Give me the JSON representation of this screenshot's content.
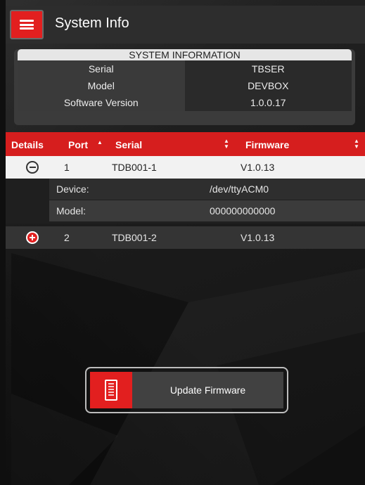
{
  "header": {
    "title": "System Info",
    "menu_icon": "hamburger-menu-icon"
  },
  "system_info": {
    "heading": "SYSTEM INFORMATION",
    "rows": [
      {
        "label": "Serial",
        "value": "TBSER"
      },
      {
        "label": "Model",
        "value": "DEVBOX"
      },
      {
        "label": "Software Version",
        "value": "1.0.0.17"
      }
    ]
  },
  "device_table": {
    "columns": {
      "details": "Details",
      "port": "Port",
      "serial": "Serial",
      "firmware": "Firmware"
    },
    "sort_icons": {
      "port": "sort-asc-icon",
      "serial": "sort-both-icon",
      "firmware": "sort-both-icon"
    },
    "rows": [
      {
        "expanded": true,
        "toggle_icon": "collapse-minus-icon",
        "port": "1",
        "serial": "TDB001-1",
        "firmware": "V1.0.13",
        "details": [
          {
            "label": "Device:",
            "value": "/dev/ttyACM0"
          },
          {
            "label": "Model:",
            "value": "000000000000"
          }
        ]
      },
      {
        "expanded": false,
        "toggle_icon": "expand-plus-icon",
        "port": "2",
        "serial": "TDB001-2",
        "firmware": "V1.0.13"
      }
    ]
  },
  "actions": {
    "update_firmware_label": "Update Firmware",
    "update_firmware_icon": "firmware-device-icon"
  },
  "colors": {
    "accent_red": "#e21f1f",
    "header_bg": "#2d2d2d",
    "table_header_red": "#d61e1e"
  }
}
